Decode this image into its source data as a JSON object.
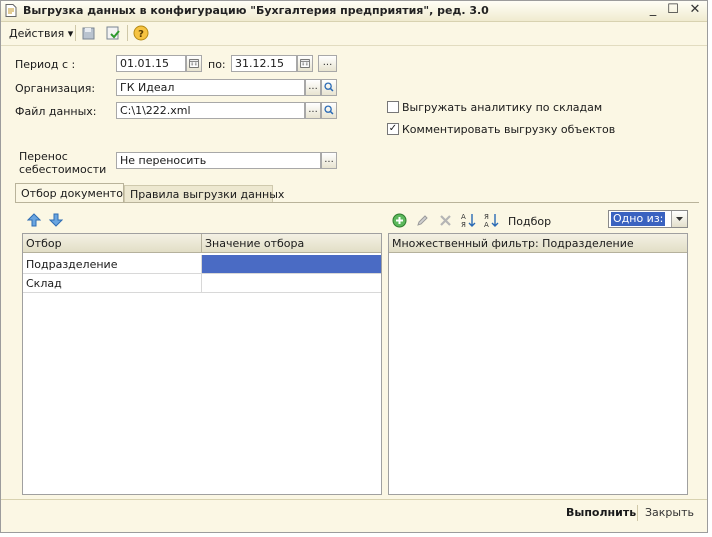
{
  "window": {
    "title": "Выгрузка данных в конфигурацию \"Бухгалтерия предприятия\", ред. 3.0",
    "buttons": [
      "_",
      "☐",
      "✕"
    ]
  },
  "toolbar": {
    "actions_label": "Действия ▾",
    "help_label": "?"
  },
  "form": {
    "period_label": "Период с :",
    "period_from": "01.01.15",
    "period_to_label": "по:",
    "period_to": "31.12.15",
    "dots": "...",
    "org_label": "Организация:",
    "org_value": "ГК Идеал",
    "file_label": "Файл данных:",
    "file_value": "C:\\1\\222.xml",
    "transfer_label_1": "Перенос",
    "transfer_label_2": "себестоимости",
    "transfer_value": "Не переносить",
    "chk_warehouse_label": "Выгружать аналитику по складам",
    "chk_warehouse_checked": false,
    "chk_comment_label": "Комментировать выгрузку объектов",
    "chk_comment_checked": true,
    "check_mark": "✓"
  },
  "tabs": [
    {
      "label": "Отбор документов",
      "active": true
    },
    {
      "label": "Правила выгрузки данных",
      "active": false
    }
  ],
  "left_table": {
    "columns": [
      "Отбор",
      "Значение отбора"
    ],
    "rows": [
      {
        "filter": "Подразделение",
        "value": ""
      },
      {
        "filter": "Склад",
        "value": ""
      }
    ],
    "selected_color": "#4a6bc4"
  },
  "right_panel": {
    "select_label": "Подбор",
    "mode_value": "Одно из:",
    "header": "Множественный фильтр: Подразделение"
  },
  "bottom": {
    "run_label": "Выполнить",
    "close_label": "Закрыть"
  }
}
